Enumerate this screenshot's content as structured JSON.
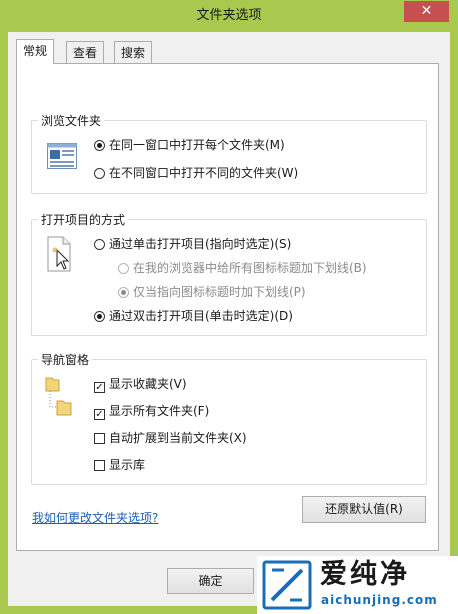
{
  "window": {
    "title": "文件夹选项",
    "close_glyph": "✕"
  },
  "tabs": [
    {
      "label": "常规"
    },
    {
      "label": "查看"
    },
    {
      "label": "搜索"
    }
  ],
  "browse_group": {
    "title": "浏览文件夹",
    "options": [
      {
        "label": "在同一窗口中打开每个文件夹(M)",
        "selected": true
      },
      {
        "label": "在不同窗口中打开不同的文件夹(W)",
        "selected": false
      }
    ]
  },
  "click_group": {
    "title": "打开项目的方式",
    "single_click": {
      "label": "通过单击打开项目(指向时选定)(S)",
      "selected": false
    },
    "underline_all": {
      "label": "在我的浏览器中给所有图标标题加下划线(B)",
      "selected": false
    },
    "underline_point": {
      "label": "仅当指向图标标题时加下划线(P)",
      "selected": true
    },
    "double_click": {
      "label": "通过双击打开项目(单击时选定)(D)",
      "selected": true
    }
  },
  "nav_group": {
    "title": "导航窗格",
    "items": [
      {
        "label": "显示收藏夹(V)",
        "checked": true
      },
      {
        "label": "显示所有文件夹(F)",
        "checked": true
      },
      {
        "label": "自动扩展到当前文件夹(X)",
        "checked": false
      },
      {
        "label": "显示库",
        "checked": false
      }
    ]
  },
  "restore_button": "还原默认值(R)",
  "help_link": "我如何更改文件夹选项?",
  "ok_button": "确定",
  "watermark": {
    "brand": "爱纯净",
    "url": "aichunjing.com"
  },
  "check_glyph": "✓"
}
